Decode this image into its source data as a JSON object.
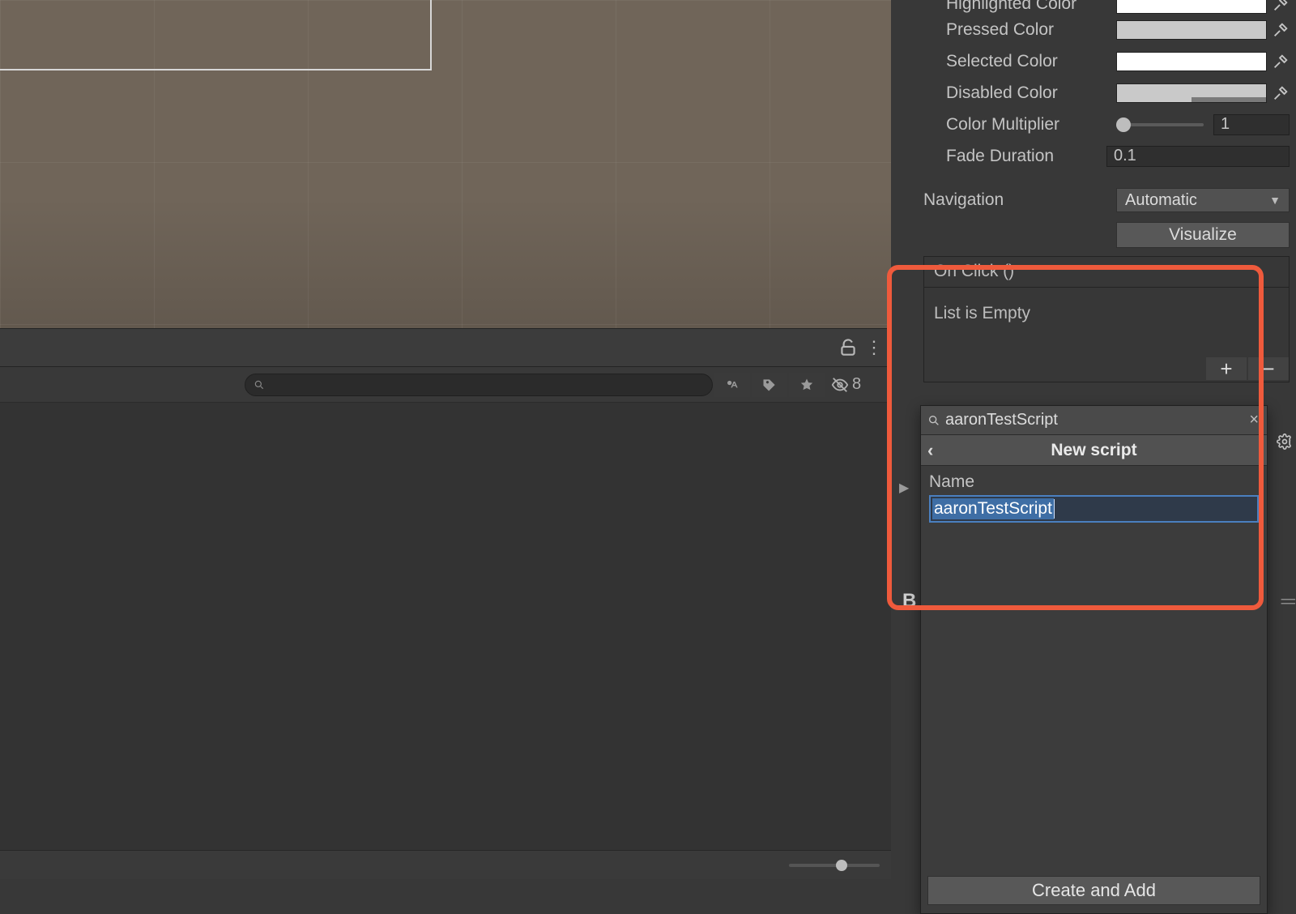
{
  "inspector": {
    "props": {
      "highlighted_color_label": "Highlighted Color",
      "pressed_color_label": "Pressed Color",
      "selected_color_label": "Selected Color",
      "disabled_color_label": "Disabled Color",
      "color_multiplier_label": "Color Multiplier",
      "color_multiplier_value": "1",
      "fade_duration_label": "Fade Duration",
      "fade_duration_value": "0.1"
    },
    "navigation": {
      "label": "Navigation",
      "value": "Automatic",
      "visualize_label": "Visualize"
    },
    "events": {
      "header": "On Click ()",
      "empty_text": "List is Empty"
    },
    "popup": {
      "search_value": "aaronTestScript",
      "title": "New script",
      "name_label": "Name",
      "name_value": "aaronTestScript",
      "create_label": "Create and Add"
    },
    "b_label": "B"
  },
  "asset_browser": {
    "hidden_count": "8"
  }
}
